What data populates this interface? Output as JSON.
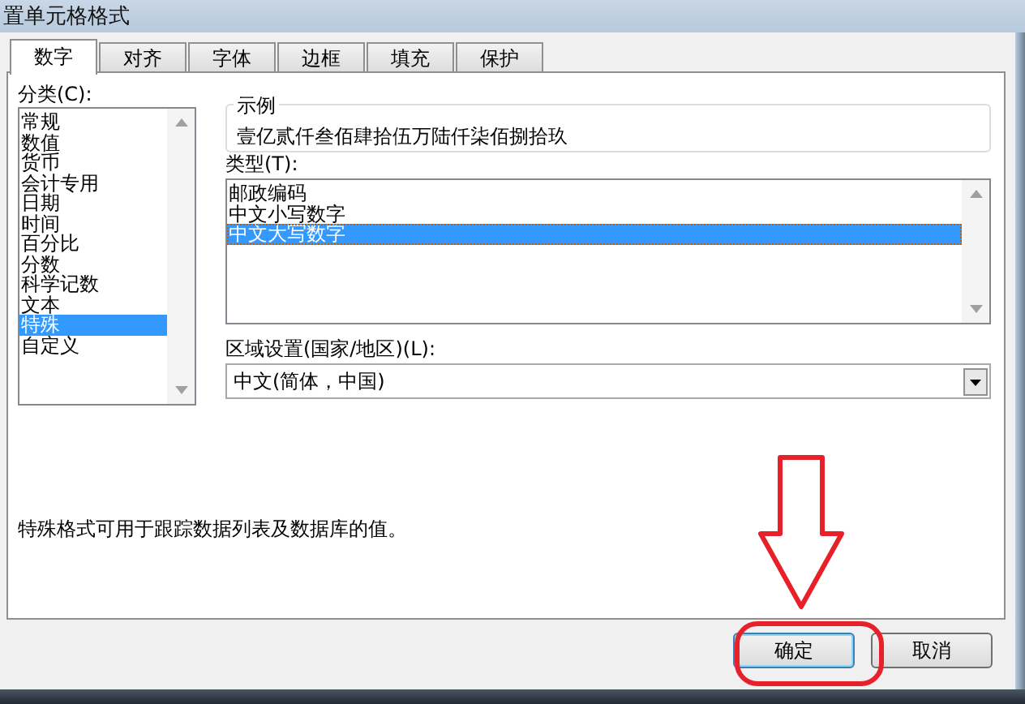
{
  "window": {
    "title": "置单元格格式"
  },
  "tabs": [
    {
      "label": "数字",
      "selected": true
    },
    {
      "label": "对齐",
      "selected": false
    },
    {
      "label": "字体",
      "selected": false
    },
    {
      "label": "边框",
      "selected": false
    },
    {
      "label": "填充",
      "selected": false
    },
    {
      "label": "保护",
      "selected": false
    }
  ],
  "category": {
    "label": "分类(C):",
    "items": [
      {
        "label": "常规",
        "selected": false
      },
      {
        "label": "数值",
        "selected": false
      },
      {
        "label": "货币",
        "selected": false
      },
      {
        "label": "会计专用",
        "selected": false
      },
      {
        "label": "日期",
        "selected": false
      },
      {
        "label": "时间",
        "selected": false
      },
      {
        "label": "百分比",
        "selected": false
      },
      {
        "label": "分数",
        "selected": false
      },
      {
        "label": "科学记数",
        "selected": false
      },
      {
        "label": "文本",
        "selected": false
      },
      {
        "label": "特殊",
        "selected": true
      },
      {
        "label": "自定义",
        "selected": false
      }
    ]
  },
  "sample": {
    "label": "示例",
    "value": "壹亿贰仟叁佰肆拾伍万陆仟柒佰捌拾玖"
  },
  "type": {
    "label": "类型(T):",
    "items": [
      {
        "label": "邮政编码",
        "selected": false
      },
      {
        "label": "中文小写数字",
        "selected": false
      },
      {
        "label": "中文大写数字",
        "selected": true
      }
    ]
  },
  "locale": {
    "label": "区域设置(国家/地区)(L):",
    "value": "中文(简体，中国)"
  },
  "description": "特殊格式可用于跟踪数据列表及数据库的值。",
  "buttons": [
    {
      "label": "确定",
      "focused": true
    },
    {
      "label": "取消",
      "focused": false
    }
  ],
  "annotations": [
    {
      "kind": "arrow"
    },
    {
      "kind": "ellipse"
    }
  ]
}
